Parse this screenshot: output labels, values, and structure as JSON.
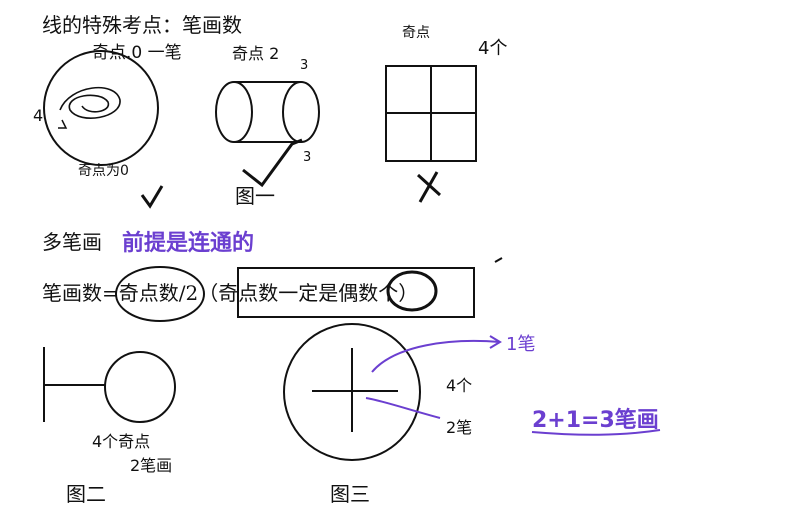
{
  "title": "线的特殊考点：笔画数",
  "section_multi": "多笔画",
  "formula": "笔画数=奇点数/2（奇点数一定是偶数个）",
  "captions": {
    "fig1": "图一",
    "fig2": "图二",
    "fig3": "图三"
  },
  "handwriting": {
    "fig1_circle_top": "奇点.0 一笔",
    "fig1_circle_left": "4",
    "fig1_circle_bottom": "奇点为0",
    "fig1_cyl_top": "奇点 2",
    "fig1_cyl_n1": "3",
    "fig1_cyl_n2": "3",
    "fig1_grid_top": "奇点",
    "fig1_grid_right": "4个",
    "purple_note": "前提是连通的",
    "fig2_note1": "4个奇点",
    "fig2_note2": "2笔画",
    "fig3_arrow": "1笔",
    "fig3_count1": "4个",
    "fig3_count2": "2笔",
    "fig3_sum": "2+1=3笔画"
  },
  "colors": {
    "ink": "#111111",
    "purple": "#6b3fd0"
  }
}
